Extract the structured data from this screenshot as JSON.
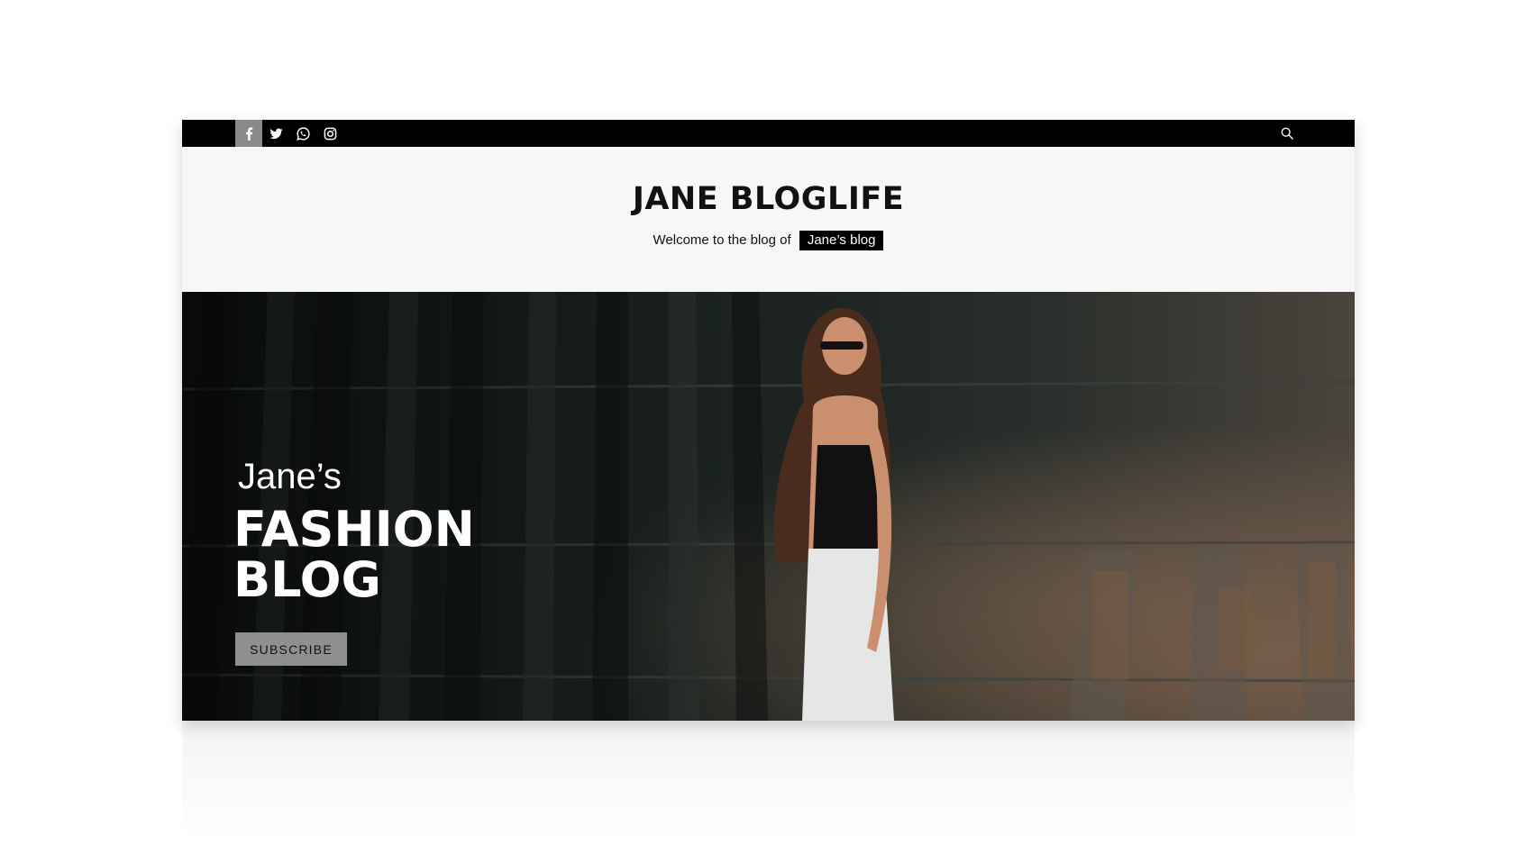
{
  "topbar": {
    "social_icons": [
      "facebook-icon",
      "twitter-icon",
      "whatsapp-icon",
      "instagram-icon"
    ],
    "active_icon": "facebook-icon",
    "search_icon": "search-icon"
  },
  "header": {
    "title": "JANE BLOGLIFE",
    "tagline_text": "Welcome to the blog of",
    "tagline_badge": "Jane’s blog"
  },
  "hero": {
    "subtitle": "Jane’s",
    "heading_line1": "FASHION",
    "heading_line2": "BLOG",
    "button_label": "SUBSCRIBE"
  },
  "colors": {
    "topbar_bg": "#000000",
    "header_bg": "#f7f7f7",
    "active_social_bg": "#8a8a8a",
    "button_bg": "#8f8f8f"
  }
}
